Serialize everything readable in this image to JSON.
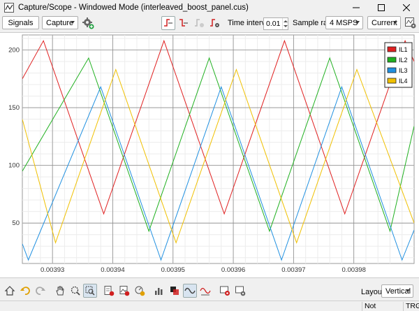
{
  "window": {
    "title": "Capture/Scope - Windowed Mode (interleaved_boost_panel.cus)",
    "controls": [
      "minimize",
      "maximize",
      "close"
    ]
  },
  "toolbar": {
    "signals_label": "Signals",
    "capture_value": "Capture",
    "time_interval_label": "Time interval",
    "time_interval_value": "0.01",
    "sample_rate_label": "Sample rate",
    "sample_rate_value": "4 MSPS",
    "mode_value": "Current",
    "icons": [
      "settings-gear-icon",
      "trigger-rising-icon",
      "trigger-falling-icon",
      "trigger-settings-disabled-icon",
      "trigger-config-icon",
      "export-settings-icon"
    ]
  },
  "bottom_toolbar": {
    "icons": [
      "home-icon",
      "undo-icon",
      "redo-icon",
      "pan-hand-icon",
      "zoom-icon",
      "zoom-area-icon",
      "export-csv-icon",
      "export-image-icon",
      "measure-icon",
      "bar-chart-icon",
      "square-wave-icon",
      "sine-wave-icon",
      "fft-icon",
      "record-icon",
      "screenshot-settings-icon"
    ],
    "layout_label": "Layout",
    "layout_value": "Vertical"
  },
  "status": {
    "availability": "Not available",
    "trigger": "TRG"
  },
  "colors": {
    "IL1": "#e02020",
    "IL2": "#20b020",
    "IL3": "#2090e0",
    "IL4": "#f0c000"
  },
  "chart_data": {
    "type": "line",
    "title": "",
    "xlabel": "",
    "ylabel": "",
    "xlim": [
      0.003925,
      0.00399
    ],
    "ylim": [
      15,
      213
    ],
    "x_ticks": [
      "0.00393",
      "0.00394",
      "0.00395",
      "0.00396",
      "0.00397",
      "0.00398"
    ],
    "x_tick_values": [
      0.00393,
      0.00394,
      0.00395,
      0.00396,
      0.00397,
      0.00398
    ],
    "y_ticks": [
      "50",
      "100",
      "150",
      "200"
    ],
    "y_tick_values": [
      50,
      100,
      150,
      200
    ],
    "grid": true,
    "legend_position": "top-right",
    "series": [
      {
        "name": "IL1",
        "x": [
          0.003925,
          0.0039285,
          0.0039385,
          0.0039485,
          0.0039585,
          0.0039685,
          0.0039785,
          0.0039885,
          0.00399
        ],
        "y": [
          175,
          208,
          58,
          208,
          58,
          208,
          58,
          208,
          190
        ]
      },
      {
        "name": "IL2",
        "x": [
          0.003925,
          0.003936,
          0.003946,
          0.003956,
          0.003966,
          0.003976,
          0.003986,
          0.00399
        ],
        "y": [
          95,
          193,
          43,
          193,
          43,
          193,
          43,
          134
        ]
      },
      {
        "name": "IL3",
        "x": [
          0.003925,
          0.003926,
          0.003938,
          0.003948,
          0.003958,
          0.003968,
          0.003978,
          0.003988,
          0.00399
        ],
        "y": [
          32,
          18,
          168,
          18,
          168,
          18,
          168,
          18,
          44
        ]
      },
      {
        "name": "IL4",
        "x": [
          0.003925,
          0.0039305,
          0.0039405,
          0.0039505,
          0.0039605,
          0.0039705,
          0.0039805,
          0.00399
        ],
        "y": [
          140,
          33,
          183,
          33,
          183,
          33,
          183,
          50
        ]
      }
    ]
  }
}
